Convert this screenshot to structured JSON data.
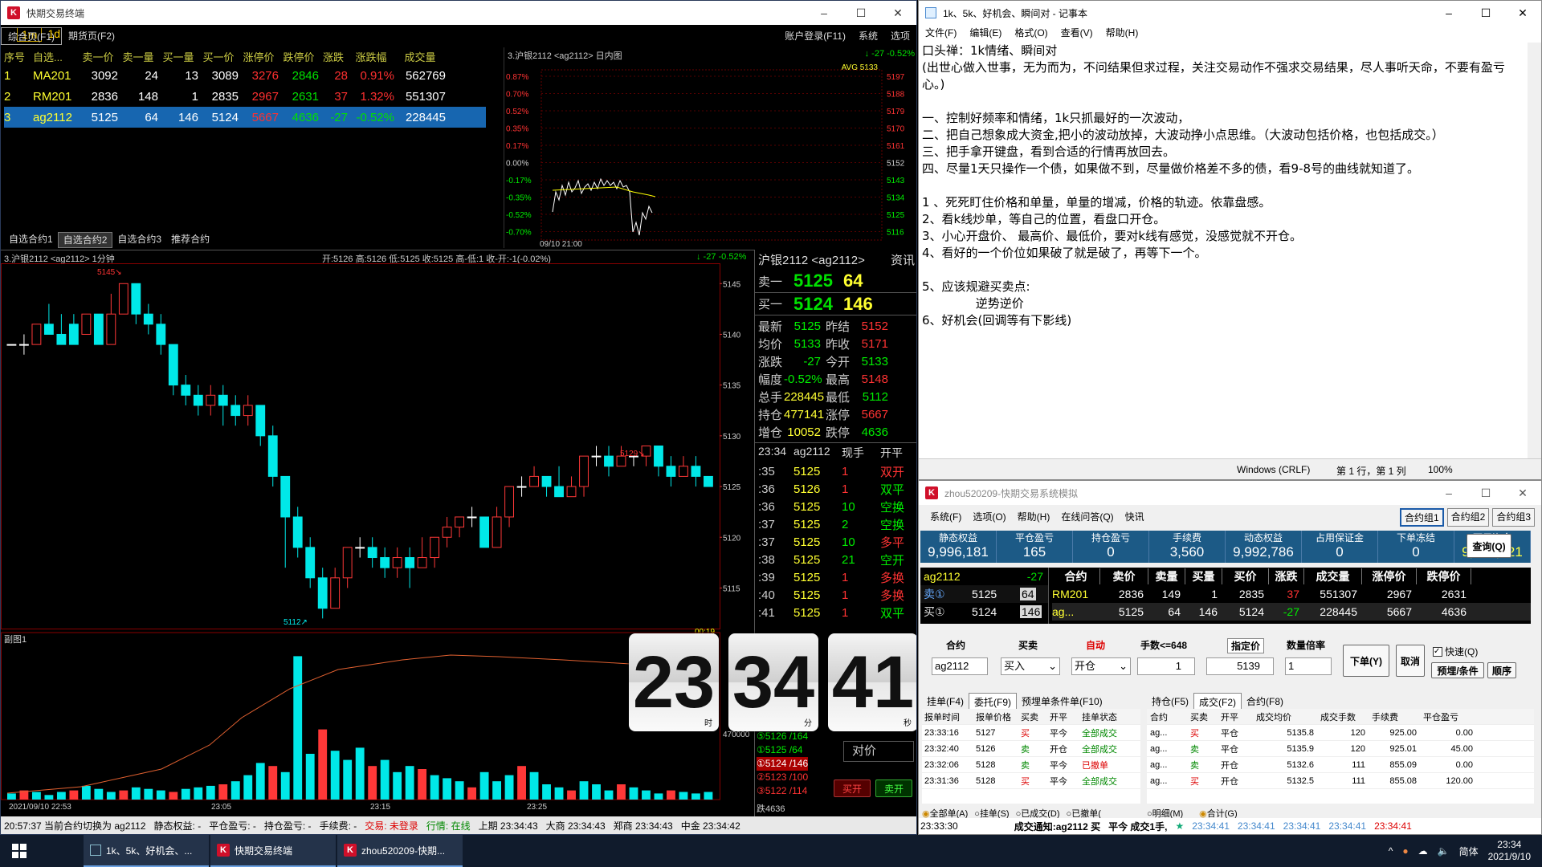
{
  "terminal": {
    "title": "快期交易终端",
    "menu": [
      "综合页(F1)",
      "期货页(F2)",
      "账户登录(F11)",
      "系统",
      "选项"
    ],
    "period_tabs": [
      "1m",
      "1d"
    ],
    "quote_headers": [
      "序号",
      "自选...",
      "卖一价",
      "卖一量",
      "买一量",
      "买一价",
      "涨停价",
      "跌停价",
      "涨跌",
      "涨跌幅",
      "成交量"
    ],
    "quotes": [
      [
        "1",
        "MA201",
        "3092",
        "24",
        "13",
        "3089",
        "3276",
        "2846",
        "28",
        "0.91%",
        "562769"
      ],
      [
        "2",
        "RM201",
        "2836",
        "148",
        "1",
        "2835",
        "2967",
        "2631",
        "37",
        "1.32%",
        "551307"
      ],
      [
        "3",
        "ag2112",
        "5125",
        "64",
        "146",
        "5124",
        "5667",
        "4636",
        "-27",
        "-0.52%",
        "228445"
      ]
    ],
    "watch_tabs": [
      "自选合约1",
      "自选合约2",
      "自选合约3",
      "推荐合约"
    ],
    "intraday": {
      "title": "3.沪银2112 <ag2112> 日内图",
      "change": "↓ -27 -0.52%",
      "avg": "AVG 5133",
      "left_ticks": [
        "0.87%",
        "0.70%",
        "0.52%",
        "0.35%",
        "0.17%",
        "0.00%",
        "-0.17%",
        "-0.35%",
        "-0.52%",
        "-0.70%"
      ],
      "right_ticks": [
        "5197",
        "5188",
        "5179",
        "5170",
        "5161",
        "5152",
        "5143",
        "5134",
        "5125",
        "5116"
      ],
      "time_label": "09/10 21:00"
    },
    "kline": {
      "title": "3.沪银2112 <ag2112> 1分钟",
      "ohlc": "开:5126 高:5126 低:5125 收:5125 高-低:1 收-开:-1(-0.02%)",
      "change": "↓ -27 -0.52%",
      "price_ticks": [
        "5145",
        "5140",
        "5135",
        "5130",
        "5125",
        "5120",
        "5115"
      ],
      "high_mark": "5145↘",
      "low_mark": "5112↗",
      "mid_mark": "5129↘",
      "countdown": "00:19",
      "sub_title": "副图1",
      "vol_tick": "470000",
      "time_labels": [
        "2021/09/10 22:53",
        "23:05",
        "23:15",
        "23:25"
      ]
    },
    "detail": {
      "name": "沪银2112 <ag2112>",
      "info": "资讯",
      "sell1_label": "卖一",
      "sell1_price": "5125",
      "sell1_vol": "64",
      "buy1_label": "买一",
      "buy1_price": "5124",
      "buy1_vol": "146",
      "stats": [
        [
          "最新",
          "5125",
          "昨结",
          "5152"
        ],
        [
          "均价",
          "5133",
          "昨收",
          "5171"
        ],
        [
          "涨跌",
          "-27",
          "今开",
          "5133"
        ],
        [
          "幅度",
          "-0.52%",
          "最高",
          "5148"
        ],
        [
          "总手",
          "228445",
          "最低",
          "5112"
        ],
        [
          "持仓",
          "477141",
          "涨停",
          "5667"
        ],
        [
          "增仓",
          "10052",
          "跌停",
          "4636"
        ]
      ],
      "tick_head": [
        "23:34",
        "ag2112",
        "现手",
        "开平"
      ],
      "ticks": [
        [
          ":35",
          "5125",
          "1",
          "双开"
        ],
        [
          ":36",
          "5126",
          "1",
          "双平"
        ],
        [
          ":36",
          "5125",
          "10",
          "空换"
        ],
        [
          ":37",
          "5125",
          "2",
          "空换"
        ],
        [
          ":37",
          "5125",
          "10",
          "多平"
        ],
        [
          ":38",
          "5125",
          "21",
          "空开"
        ],
        [
          ":39",
          "5125",
          "1",
          "多换"
        ],
        [
          ":40",
          "5125",
          "1",
          "多换"
        ],
        [
          ":41",
          "5125",
          "1",
          "双平"
        ]
      ],
      "depth": [
        "⑤5126 /164",
        "①5125 /64",
        "①5124 /146",
        "②5123 /100",
        "③5122 /114"
      ],
      "vs_price": "对价",
      "buy_open": "买开",
      "sell_open": "卖开",
      "fall": "跌4636"
    },
    "clock": {
      "h": "23",
      "m": "34",
      "s": "41",
      "hl": "时",
      "ml": "分",
      "sl": "秒"
    },
    "status": [
      "20:57:37 当前合约切换为 ag2112",
      "静态权益: -",
      "平仓盈亏: -",
      "持仓盈亏: -",
      "手续费: -",
      "交易: 未登录",
      "行情: 在线",
      "上期 23:34:43",
      "大商 23:34:43",
      "郑商 23:34:43",
      "中金 23:34:42"
    ]
  },
  "notepad": {
    "title": "1k、5k、好机会、瞬间对 - 记事本",
    "menu": [
      "文件(F)",
      "编辑(E)",
      "格式(O)",
      "查看(V)",
      "帮助(H)"
    ],
    "text": "口头禅：1k情绪、瞬间对\n(出世心做入世事，无为而为，不问结果但求过程，关注交易动作不强求交易结果，尽人事听天命，不要有盈亏心。)\n\n一、控制好频率和情绪，1k只抓最好的一次波动，\n二、把自己想象成大资金,把小的波动放掉，大波动挣小点思维。（大波动包括价格，也包括成交。）\n三、把手拿开键盘，看到合适的行情再放回去。\n四、尽量1天只操作一个债，如果做不到，尽量做价格差不多的债，看9-8号的曲线就知道了。\n\n1 、死死盯住价格和单量，单量的增减，价格的轨迹。依靠盘感。\n2、看k线炒单，等自己的位置，看盘口开仓。\n3、小心开盘价、 最高价、最低价，要对k线有感觉，没感觉就不开仓。\n4、看好的一个价位如果破了就是破了，再等下一个。\n\n5、应该规避买卖点:\n              逆势逆价\n6、好机会(回调等有下影线)",
    "status": [
      "Windows (CRLF)",
      "第 1 行，第 1 列",
      "100%"
    ]
  },
  "sim": {
    "title": "zhou520209-快期交易系统模拟",
    "menu": [
      "系统(F)",
      "选项(O)",
      "帮助(H)",
      "在线问答(Q)",
      "快讯"
    ],
    "groups": [
      "合约组1",
      "合约组2",
      "合约组3"
    ],
    "account": [
      [
        "静态权益",
        "9,996,181"
      ],
      [
        "平仓盈亏",
        "165"
      ],
      [
        "持仓盈亏",
        "0"
      ],
      [
        "手续费",
        "3,560"
      ],
      [
        "动态权益",
        "9,992,786"
      ],
      [
        "占用保证金",
        "0"
      ],
      [
        "下单冻结",
        "0"
      ],
      [
        "可用资金",
        "9,992,621"
      ]
    ],
    "query": "查询(Q)",
    "contract": "ag2112",
    "contract_chg": "-27",
    "sell_label": "卖①",
    "sell_price": "5125",
    "sell_vol": "64",
    "buy_label": "买①",
    "buy_price": "5124",
    "buy_vol": "146",
    "q2_head": [
      "合约",
      "卖价",
      "卖量",
      "买量",
      "买价",
      "涨跌",
      "成交量",
      "涨停价",
      "跌停价"
    ],
    "q2_rows": [
      [
        "RM201",
        "2836",
        "149",
        "1",
        "2835",
        "37",
        "551307",
        "2967",
        "2631"
      ],
      [
        "ag...",
        "5125",
        "64",
        "146",
        "5124",
        "-27",
        "228445",
        "5667",
        "4636"
      ]
    ],
    "form_labels": [
      "合约",
      "买卖",
      "自动",
      "手数<=648",
      "指定价",
      "数量倍率"
    ],
    "form_values": {
      "contract": "ag2112",
      "side": "买入",
      "offset": "开仓",
      "qty": "1",
      "price": "5139",
      "mult": "1"
    },
    "buttons": {
      "order": "下单(Y)",
      "cancel": "取消",
      "fast": "快速(Q)",
      "preset": "预埋/条件",
      "order_seq": "顺序"
    },
    "left_tabs": [
      "挂单(F4)",
      "委托(F9)",
      "预埋单条件单(F10)"
    ],
    "orders_head": [
      "报单时间",
      "报单价格",
      "买卖",
      "开平",
      "挂单状态"
    ],
    "orders": [
      [
        "23:33:16",
        "5127",
        "买",
        "平今",
        "全部成交"
      ],
      [
        "23:32:40",
        "5126",
        "卖",
        "开仓",
        "全部成交"
      ],
      [
        "23:32:06",
        "5128",
        "卖",
        "平今",
        "已撤单"
      ],
      [
        "23:31:36",
        "5128",
        "买",
        "平今",
        "全部成交"
      ]
    ],
    "left_radios": [
      "全部单(A)",
      "挂单(S)",
      "已成交(D)",
      "已撤单("
    ],
    "right_tabs": [
      "持仓(F5)",
      "成交(F2)",
      "合约(F8)"
    ],
    "trades_head": [
      "合约",
      "买卖",
      "开平",
      "成交均价",
      "成交手数",
      "手续费",
      "平仓盈亏"
    ],
    "trades": [
      [
        "ag...",
        "买",
        "平仓",
        "5135.8",
        "120",
        "925.00",
        "0.00"
      ],
      [
        "ag...",
        "卖",
        "平仓",
        "5135.9",
        "120",
        "925.01",
        "45.00"
      ],
      [
        "ag...",
        "卖",
        "开仓",
        "5132.6",
        "111",
        "855.09",
        "0.00"
      ],
      [
        "ag...",
        "买",
        "开仓",
        "5132.5",
        "111",
        "855.08",
        "120.00"
      ]
    ],
    "right_radios": [
      "明细(M)",
      "合计(G)"
    ],
    "bottom": [
      "23:33:30",
      "成交通知:ag2112 买",
      "平今 成交1手,",
      "23:34:41",
      "23:34:41",
      "23:34:41",
      "23:34:41",
      "23:34:41"
    ]
  },
  "taskbar": {
    "apps": [
      "1k、5k、好机会、...",
      "快期交易终端",
      "zhou520209-快期..."
    ],
    "time": "23:34",
    "date": "2021/9/10",
    "ime": "简体"
  }
}
